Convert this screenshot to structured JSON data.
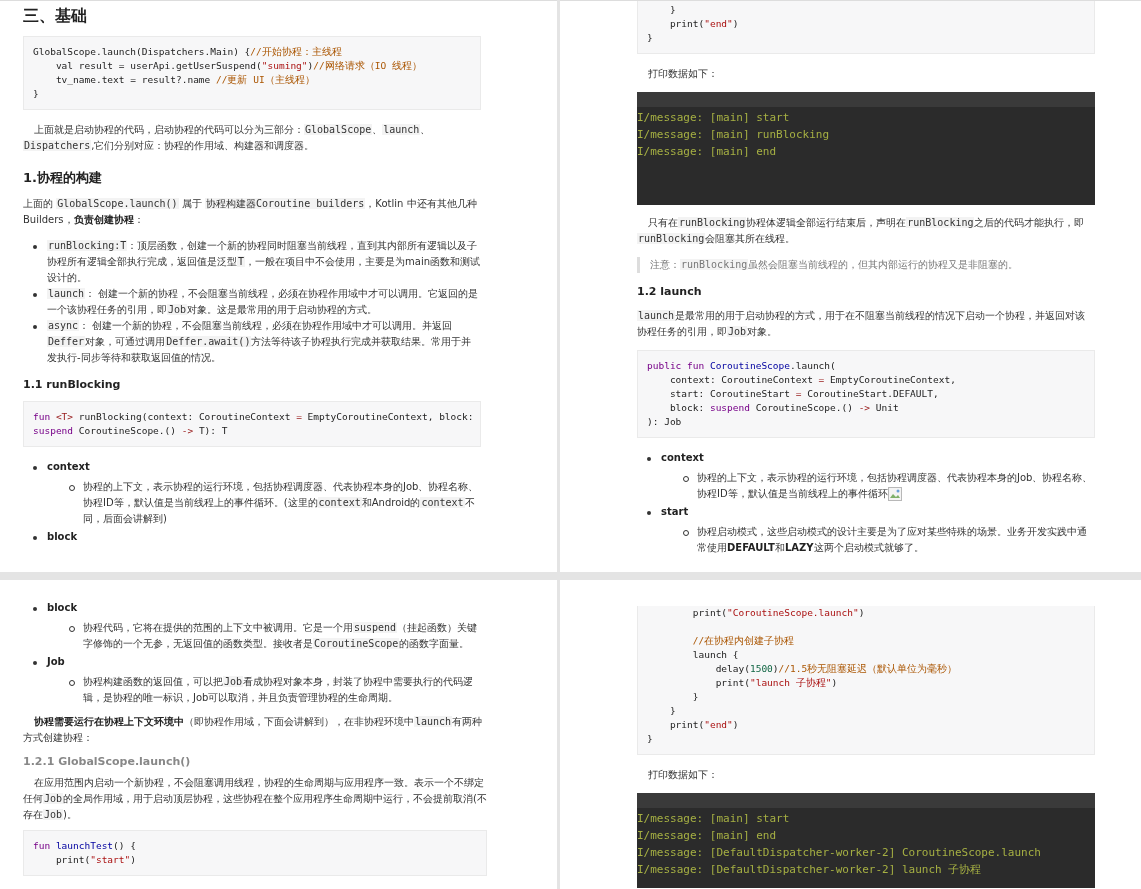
{
  "pages": [
    {
      "blocks": [
        {
          "kind": "h2",
          "text": "三、基础"
        },
        {
          "kind": "code",
          "lines": [
            [
              {
                "kind": "plain",
                "text": "GlobalScope.launch(Dispatchers.Main) {"
              },
              {
                "kind": "comment",
                "text": "//开始协程：主线程"
              }
            ],
            [
              {
                "kind": "plain",
                "text": "    val result = userApi.getUserSuspend("
              },
              {
                "kind": "str",
                "text": "\"suming\""
              },
              {
                "kind": "plain",
                "text": ")"
              },
              {
                "kind": "comment",
                "text": "//网络请求（IO 线程）"
              }
            ],
            [
              {
                "kind": "plain",
                "text": "    tv_name.text = result?.name "
              },
              {
                "kind": "comment",
                "text": "//更新 UI（主线程）"
              }
            ],
            [
              {
                "kind": "plain",
                "text": "}"
              }
            ]
          ]
        },
        {
          "kind": "para",
          "indent": true,
          "runs": [
            "上面就是启动协程的代码，启动协程的代码可以分为三部分：",
            {
              "kind": "code",
              "text": "GlobalScope"
            },
            "、",
            {
              "kind": "code",
              "text": "launch"
            },
            "、",
            {
              "kind": "code",
              "text": "Dispatchers"
            },
            ",它们分别对应：协程的作用域、构建器和调度器。"
          ]
        },
        {
          "kind": "h3",
          "text": "1.协程的构建"
        },
        {
          "kind": "para",
          "indent": false,
          "runs": [
            "上面的 ",
            {
              "kind": "code",
              "text": "GlobalScope.launch()"
            },
            " 属于 ",
            {
              "kind": "code",
              "text": "协程构建器Coroutine builders"
            },
            "，Kotlin 中还有其他几种 Builders，",
            {
              "kind": "bold",
              "text": "负责创建协程"
            },
            "："
          ]
        },
        {
          "kind": "bullets",
          "items": [
            [
              {
                "kind": "code",
                "text": "runBlocking:T"
              },
              "：顶层函数，创建一个新的协程同时阻塞当前线程，直到其内部所有逻辑以及子协程所有逻辑全部执行完成，返回值是泛型",
              {
                "kind": "code",
                "text": "T"
              },
              "，一般在项目中不会使用，主要是为main函数和测试设计的。"
            ],
            [
              {
                "kind": "code",
                "text": "launch"
              },
              "：  创建一个新的协程，不会阻塞当前线程，必须在协程作用域中才可以调用。它返回的是一个该协程任务的引用，即",
              {
                "kind": "code",
                "text": "Job"
              },
              "对象。这是最常用的用于启动协程的方式。"
            ],
            [
              {
                "kind": "code",
                "text": "async"
              },
              "：  创建一个新的协程，不会阻塞当前线程，必须在协程作用域中才可以调用。并返回",
              {
                "kind": "code",
                "text": "Deffer"
              },
              "对象，可通过调用",
              {
                "kind": "code",
                "text": "Deffer.await()"
              },
              "方法等待该子协程执行完成并获取结果。常用于并发执行-同步等待和获取返回值的情况。"
            ]
          ]
        },
        {
          "kind": "h4",
          "text": "1.1 runBlocking"
        },
        {
          "kind": "code",
          "lines": [
            [
              {
                "kind": "kw",
                "text": "fun "
              },
              {
                "kind": "op",
                "text": "<T>"
              },
              {
                "kind": "plain",
                "text": " runBlocking(context: CoroutineContext "
              },
              {
                "kind": "op",
                "text": "="
              },
              {
                "kind": "plain",
                "text": " EmptyCoroutineContext, block:"
              }
            ],
            [
              {
                "kind": "kw",
                "text": "suspend"
              },
              {
                "kind": "plain",
                "text": " CoroutineScope.() "
              },
              {
                "kind": "op",
                "text": "->"
              },
              {
                "kind": "plain",
                "text": " T): T"
              }
            ]
          ]
        },
        {
          "kind": "defs",
          "items": [
            {
              "term": "context",
              "desc": [
                {
                  "image_missing": false,
                  "runs": [
                    "协程的上下文，表示协程的运行环境，包括协程调度器、代表协程本身的Job、协程名称、协程ID等，默认值是当前线程上的事件循环。(这里的",
                    {
                      "kind": "code",
                      "text": "context"
                    },
                    "和Android的",
                    {
                      "kind": "code",
                      "text": "context"
                    },
                    "不同，后面会讲解到)"
                  ]
                }
              ]
            },
            {
              "term": "block"
            }
          ]
        }
      ]
    },
    {
      "blocks": [
        {
          "kind": "code",
          "lines": [
            [
              {
                "kind": "plain",
                "text": "    }"
              }
            ],
            [
              {
                "kind": "plain",
                "text": "    print("
              },
              {
                "kind": "str",
                "text": "\"end\""
              },
              {
                "kind": "plain",
                "text": ")"
              }
            ],
            [
              {
                "kind": "plain",
                "text": "}"
              }
            ]
          ]
        },
        {
          "kind": "para",
          "indent": true,
          "runs": [
            "打印数据如下："
          ]
        },
        {
          "kind": "console",
          "lines": [
            "I/message: [main] start",
            "I/message: [main] runBlocking",
            "I/message: [main] end"
          ]
        },
        {
          "kind": "para",
          "indent": true,
          "runs": [
            "只有在",
            {
              "kind": "code",
              "text": "runBlocking"
            },
            "协程体逻辑全部运行结束后，声明在",
            {
              "kind": "code",
              "text": "runBlocking"
            },
            "之后的代码才能执行，即",
            {
              "kind": "code",
              "text": "runBlocking"
            },
            "会阻塞其所在线程。"
          ]
        },
        {
          "kind": "note",
          "runs": [
            "注意：",
            {
              "kind": "code",
              "text": "runBlocking"
            },
            "虽然会阻塞当前线程的，但其内部运行的协程又是非阻塞的。"
          ]
        },
        {
          "kind": "h4",
          "text": "1.2 launch"
        },
        {
          "kind": "para",
          "indent": false,
          "runs": [
            {
              "kind": "code",
              "text": "launch"
            },
            "是最常用的用于启动协程的方式，用于在不阻塞当前线程的情况下启动一个协程，并返回对该协程任务的引用，即",
            {
              "kind": "code",
              "text": "Job"
            },
            "对象。"
          ]
        },
        {
          "kind": "code",
          "lines": [
            [
              {
                "kind": "kw",
                "text": "public fun "
              },
              {
                "kind": "type",
                "text": "CoroutineScope"
              },
              {
                "kind": "plain",
                "text": ".launch("
              }
            ],
            [
              {
                "kind": "plain",
                "text": "    context: CoroutineContext "
              },
              {
                "kind": "op",
                "text": "="
              },
              {
                "kind": "plain",
                "text": " EmptyCoroutineContext,"
              }
            ],
            [
              {
                "kind": "plain",
                "text": "    start: CoroutineStart "
              },
              {
                "kind": "op",
                "text": "="
              },
              {
                "kind": "plain",
                "text": " CoroutineStart.DEFAULT,"
              }
            ],
            [
              {
                "kind": "plain",
                "text": "    block: "
              },
              {
                "kind": "kw",
                "text": "suspend"
              },
              {
                "kind": "plain",
                "text": " CoroutineScope.() "
              },
              {
                "kind": "op",
                "text": "->"
              },
              {
                "kind": "plain",
                "text": " Unit"
              }
            ],
            [
              {
                "kind": "plain",
                "text": "): Job"
              }
            ]
          ]
        },
        {
          "kind": "defs",
          "items": [
            {
              "term": "context",
              "desc": [
                {
                  "image_missing": true,
                  "runs": [
                    "协程的上下文，表示协程的运行环境，包括协程调度器、代表协程本身的Job、协程名称、协程ID等，默认值是当前线程上的事件循环"
                  ]
                }
              ]
            },
            {
              "term": "start",
              "desc": [
                {
                  "image_missing": false,
                  "runs": [
                    "协程启动模式，这些启动模式的设计主要是为了应对某些特殊的场景。业务开发实践中通常使用",
                    {
                      "kind": "bold",
                      "text": "DEFAULT"
                    },
                    "和",
                    {
                      "kind": "bold",
                      "text": "LAZY"
                    },
                    "这两个启动模式就够了。"
                  ]
                }
              ]
            }
          ]
        }
      ]
    },
    {
      "blocks": [
        {
          "kind": "defs",
          "items": [
            {
              "term": "block",
              "desc": [
                {
                  "image_missing": false,
                  "runs": [
                    "协程代码，它将在提供的范围的上下文中被调用。它是一个用",
                    {
                      "kind": "code",
                      "text": "suspend"
                    },
                    "（挂起函数）关键字修饰的一个无参，无返回值的函数类型。接收者是",
                    {
                      "kind": "code",
                      "text": "CoroutineScope"
                    },
                    "的函数字面量。"
                  ]
                }
              ]
            },
            {
              "term": "Job",
              "desc": [
                {
                  "image_missing": false,
                  "runs": [
                    "协程构建函数的返回值，可以把",
                    {
                      "kind": "code",
                      "text": "Job"
                    },
                    "看成协程对象本身，封装了协程中需要执行的代码逻辑，是协程的唯一标识，Job可以取消，并且负责管理协程的生命周期。"
                  ]
                }
              ]
            }
          ]
        },
        {
          "kind": "para",
          "indent": true,
          "runs": [
            {
              "kind": "bold",
              "text": "协程需要运行在协程上下文环境中"
            },
            "（即协程作用域，下面会讲解到），在非协程环境中",
            {
              "kind": "code",
              "text": "launch"
            },
            "有两种方式创建协程："
          ]
        },
        {
          "kind": "h5",
          "text": "1.2.1 GlobalScope.launch()"
        },
        {
          "kind": "para",
          "indent": true,
          "runs": [
            "在应用范围内启动一个新协程，不会阻塞调用线程，协程的生命周期与应用程序一致。表示一个不绑定任何",
            {
              "kind": "code",
              "text": "Job"
            },
            "的全局作用域，用于启动顶层协程，这些协程在整个应用程序生命周期中运行，不会提前取消(不存在",
            {
              "kind": "code",
              "text": "Job"
            },
            ")。"
          ]
        },
        {
          "kind": "code",
          "lines": [
            [
              {
                "kind": "kw",
                "text": "fun "
              },
              {
                "kind": "type",
                "text": "launchTest"
              },
              {
                "kind": "plain",
                "text": "() {"
              }
            ],
            [
              {
                "kind": "plain",
                "text": "    print("
              },
              {
                "kind": "str",
                "text": "\"start\""
              },
              {
                "kind": "plain",
                "text": ")"
              }
            ]
          ]
        }
      ]
    },
    {
      "blocks": [
        {
          "kind": "code",
          "groups": [
            [
              [
                {
                  "kind": "plain",
                  "text": "        print("
                },
                {
                  "kind": "str",
                  "text": "\"CoroutineScope.launch\""
                },
                {
                  "kind": "plain",
                  "text": ")"
                }
              ]
            ],
            [
              [
                {
                  "kind": "comment",
                  "text": "        //在协程内创建子协程"
                }
              ],
              [
                {
                  "kind": "plain",
                  "text": "        launch {"
                }
              ],
              [
                {
                  "kind": "plain",
                  "text": "            delay("
                },
                {
                  "kind": "num",
                  "text": "1500"
                },
                {
                  "kind": "plain",
                  "text": ")"
                },
                {
                  "kind": "comment",
                  "text": "//1.5秒无阻塞延迟（默认单位为毫秒）"
                }
              ],
              [
                {
                  "kind": "plain",
                  "text": "            print("
                },
                {
                  "kind": "str",
                  "text": "\"launch 子协程\""
                },
                {
                  "kind": "plain",
                  "text": ")"
                }
              ],
              [
                {
                  "kind": "plain",
                  "text": "        }"
                }
              ],
              [
                {
                  "kind": "plain",
                  "text": "    }"
                }
              ],
              [
                {
                  "kind": "plain",
                  "text": "    print("
                },
                {
                  "kind": "str",
                  "text": "\"end\""
                },
                {
                  "kind": "plain",
                  "text": ")"
                }
              ],
              [
                {
                  "kind": "plain",
                  "text": "}"
                }
              ]
            ]
          ]
        },
        {
          "kind": "para",
          "indent": true,
          "runs": [
            "打印数据如下："
          ]
        },
        {
          "kind": "console",
          "lines": [
            "I/message: [main] start",
            "I/message: [main] end",
            "I/message: [DefaultDispatcher-worker-2] CoroutineScope.launch",
            "I/message: [DefaultDispatcher-worker-2] launch 子协程"
          ]
        }
      ]
    }
  ]
}
